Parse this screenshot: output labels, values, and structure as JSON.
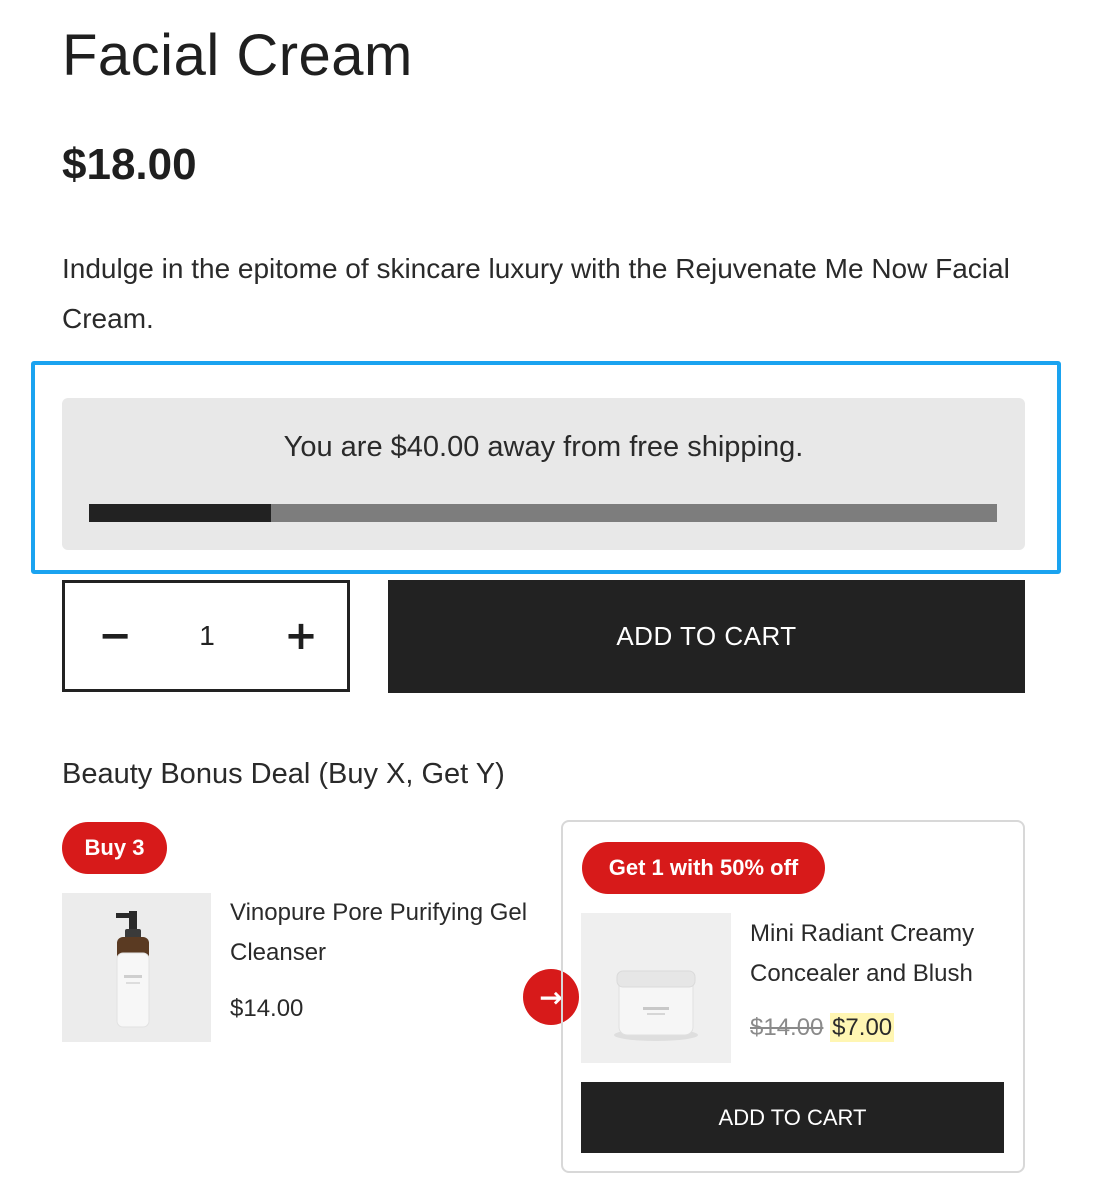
{
  "product": {
    "title": "Facial Cream",
    "price": "$18.00",
    "description": "Indulge in the epitome of skincare luxury with the Rejuvenate Me Now Facial Cream."
  },
  "shipping": {
    "message": "You are $40.00 away from free shipping.",
    "progress_fraction": 0.2
  },
  "quantity": {
    "minus_label": "−",
    "value": "1",
    "plus_label": "+"
  },
  "add_to_cart_label": "ADD TO CART",
  "deal": {
    "title": "Beauty Bonus Deal (Buy X, Get Y)",
    "buy_badge": "Buy 3",
    "get_badge": "Get 1 with 50% off",
    "arrow_icon": "→",
    "buy_product": {
      "name": "Vinopure Pore Purifying Gel Cleanser",
      "price": "$14.00"
    },
    "get_product": {
      "name": "Mini Radiant Creamy Concealer and Blush",
      "original_price": "$14.00",
      "sale_price": "$7.00"
    },
    "add_to_cart_label": "ADD TO CART"
  },
  "colors": {
    "accent_red": "#d71a1a",
    "highlight_blue": "#1aa3f0",
    "button_dark": "#222222"
  }
}
